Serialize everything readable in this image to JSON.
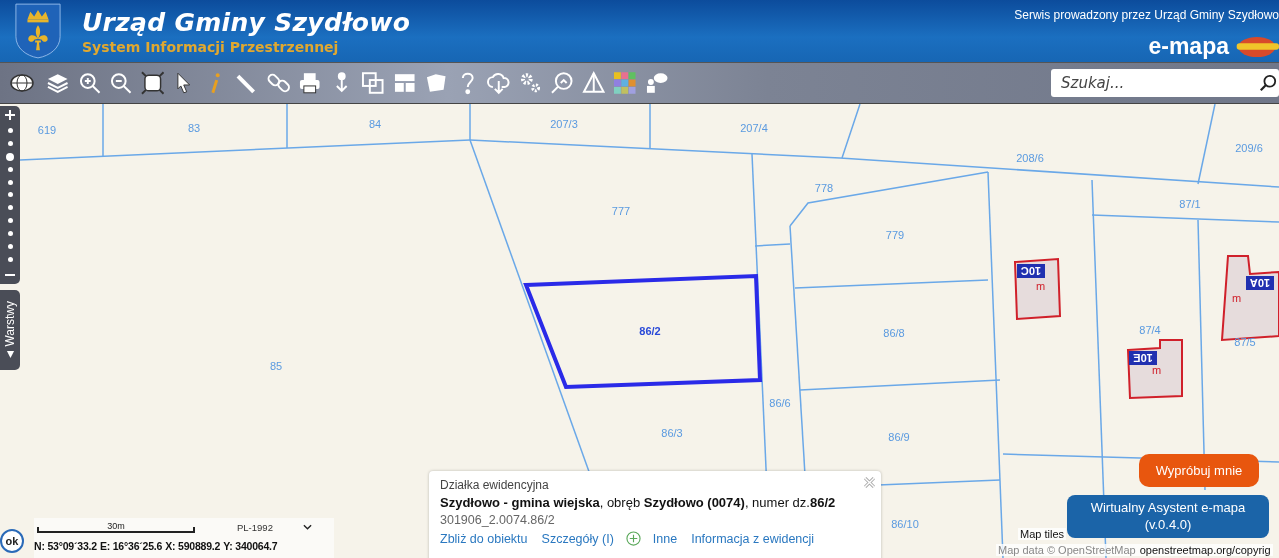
{
  "header": {
    "title": "Urząd Gminy Szydłowo",
    "subtitle": "System Informacji Przestrzennej",
    "operator": "Serwis prowadzony przez Urząd Gminy Szydłowo",
    "brand": "e-mapa"
  },
  "search": {
    "placeholder": "Szukaj..."
  },
  "zoom_slider": {
    "level": 0.8
  },
  "layers_tab": {
    "label": "Warstwy"
  },
  "parcels": [
    {
      "label": "619",
      "selected": false
    },
    {
      "label": "83",
      "selected": false
    },
    {
      "label": "84",
      "selected": false
    },
    {
      "label": "207/3",
      "selected": false
    },
    {
      "label": "207/4",
      "selected": false
    },
    {
      "label": "208/6",
      "selected": false
    },
    {
      "label": "209/6",
      "selected": false
    },
    {
      "label": "778",
      "selected": false
    },
    {
      "label": "87/1",
      "selected": false
    },
    {
      "label": "777",
      "selected": false
    },
    {
      "label": "779",
      "selected": false
    },
    {
      "label": "86/2",
      "selected": true
    },
    {
      "label": "86/8",
      "selected": false
    },
    {
      "label": "85",
      "selected": false
    },
    {
      "label": "86/6",
      "selected": false
    },
    {
      "label": "86/3",
      "selected": false
    },
    {
      "label": "86/9",
      "selected": false
    },
    {
      "label": "86/10",
      "selected": false
    },
    {
      "label": "87/4",
      "selected": false
    },
    {
      "label": "87/5",
      "selected": false
    }
  ],
  "buildings": [
    {
      "number": "10C",
      "mark": "m"
    },
    {
      "number": "10E",
      "mark": "m"
    },
    {
      "number": "10A",
      "mark": "m"
    }
  ],
  "popup": {
    "heading": "Działka ewidencyjna",
    "description": "**Szydłowo - gmina wiejska**, obręb **Szydłowo (0074)**, numer dz.**86/2**",
    "identifier": "301906_2.0074.86/2",
    "links": [
      "Zbliż do obiektu",
      "Szczegóły (I)",
      "Inne",
      "Informacja z ewidencji"
    ]
  },
  "ok_button": "ok",
  "scale": {
    "label": "30m"
  },
  "projection": "PL-1992",
  "coordinates": [
    "N: 53°09´33.2",
    "E: 16°36´25.6",
    "X: 590889.2",
    "Y: 340064.7"
  ],
  "assistant": {
    "prompt": "Wypróbuj mnie",
    "title": "Wirtualny Asystent e-mapa",
    "version": "(v.0.4.0)"
  },
  "attribution": [
    "Map tiles",
    "Map data © OpenStreetMap",
    "openstreetmap.org/copyrig"
  ]
}
